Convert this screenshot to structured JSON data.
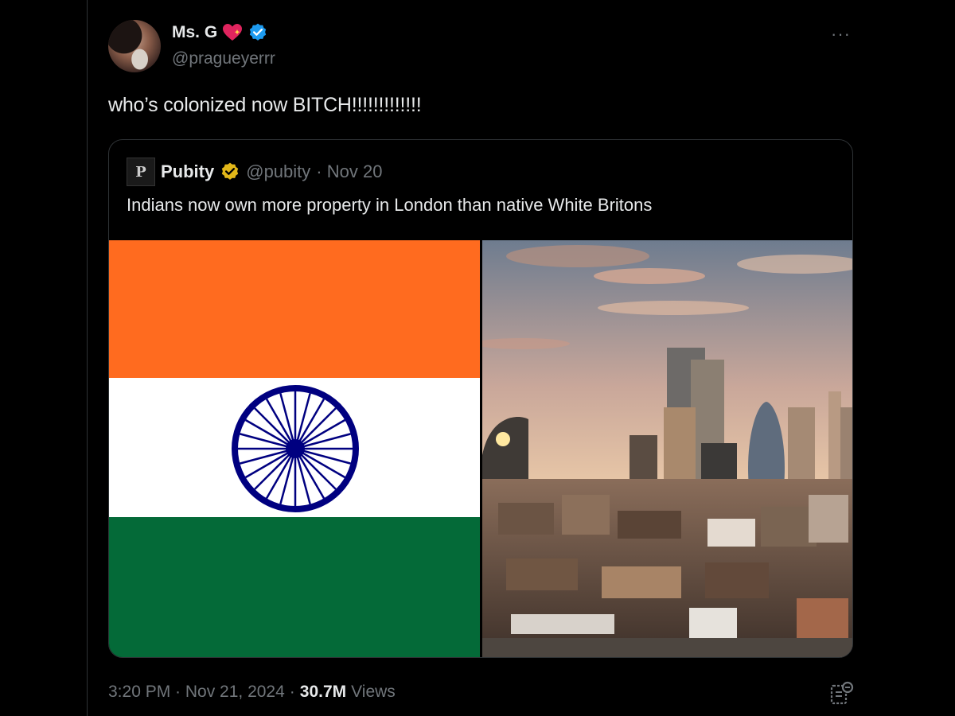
{
  "author": {
    "display_name": "Ms. G",
    "handle": "@pragueyerrr",
    "badges": [
      "sparkling-heart-icon",
      "verified-icon"
    ]
  },
  "tweet": {
    "text": "who’s colonized now BITCH!!!!!!!!!!!!!",
    "timestamp": "3:20 PM · Nov 21, 2024",
    "separator": "·",
    "views_count": "30.7M",
    "views_label": "Views"
  },
  "quoted": {
    "logo_letter": "P",
    "name": "Pubity",
    "handle": "@pubity",
    "date": "· Nov 20",
    "text": "Indians now own more property in London than native White Britons",
    "media": [
      "india-flag-image",
      "london-skyline-photo"
    ]
  },
  "colors": {
    "background": "#000000",
    "text": "#e7e9ea",
    "muted": "#71767b",
    "verified_blue": "#1d9bf0",
    "verified_gold": "#e2b719",
    "saffron": "#ff6b1f",
    "india_green": "#046a38",
    "chakra_blue": "#000080"
  }
}
